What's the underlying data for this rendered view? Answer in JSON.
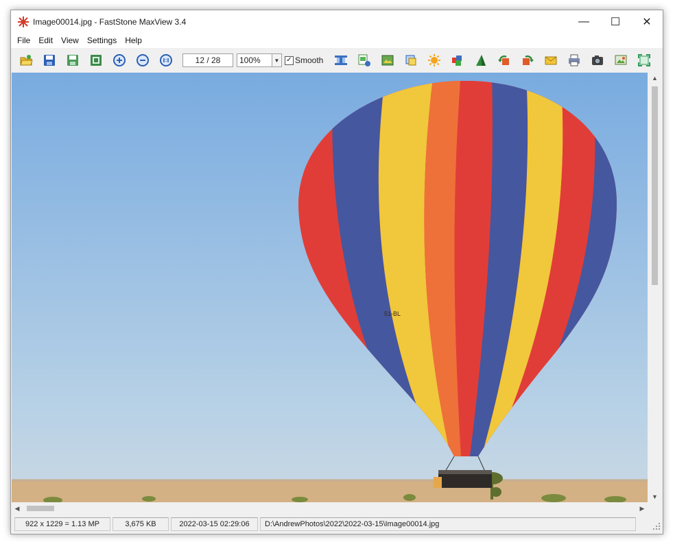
{
  "window": {
    "title": "Image00014.jpg - FastStone MaxView 3.4",
    "controls": {
      "minimize": "—",
      "maximize": "☐",
      "close": "✕"
    }
  },
  "menu": {
    "items": [
      "File",
      "Edit",
      "View",
      "Settings",
      "Help"
    ]
  },
  "toolbar": {
    "page_counter": "12 / 28",
    "zoom": "100%",
    "smooth_label": "Smooth",
    "smooth_checked": true,
    "icons": [
      "open-folder-icon",
      "save-icon",
      "save-as-icon",
      "export-icon",
      "zoom-in-icon",
      "zoom-out-icon",
      "actual-size-icon",
      "filmstrip-icon",
      "image-info-icon",
      "resize-icon",
      "crop-icon",
      "adjust-icon",
      "colors-icon",
      "sharpen-icon",
      "rotate-left-icon",
      "rotate-right-icon",
      "email-icon",
      "print-icon",
      "camera-icon",
      "slideshow-icon",
      "fullscreen-icon"
    ]
  },
  "image": {
    "balloon_mark": "51-BL"
  },
  "status": {
    "dimensions": "922 x 1229 = 1.13 MP",
    "file_size": "3,675 KB",
    "date": "2022-03-15 02:29:06",
    "path": "D:\\AndrewPhotos\\2022\\2022-03-15\\Image00014.jpg"
  },
  "colors": {
    "sky_top": "#79abe0",
    "sky_bottom": "#b9d2e6",
    "ground": "#d3b184",
    "balloon_red": "#e0332e",
    "balloon_blue": "#3b4f9a",
    "balloon_yellow": "#f1c532",
    "balloon_orange": "#ee6a2f"
  }
}
